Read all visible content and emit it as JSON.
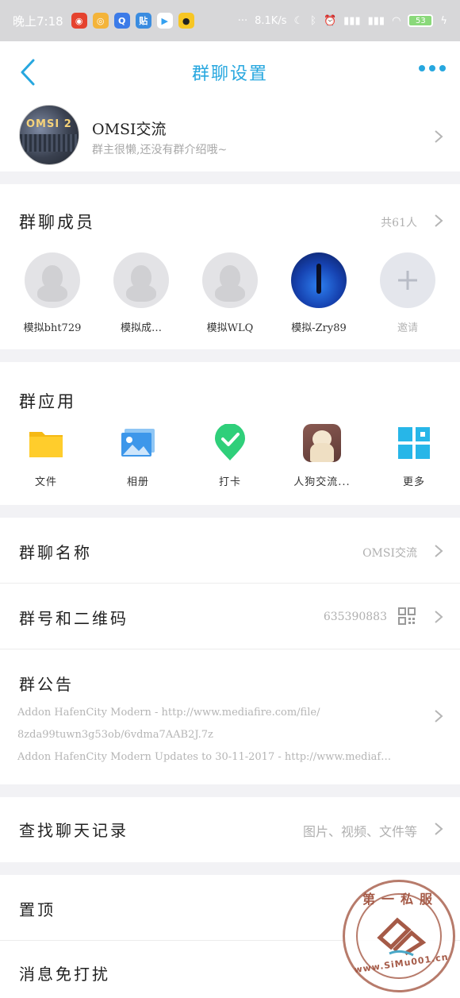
{
  "status_bar": {
    "time": "晚上7:18",
    "dots": "···",
    "speed": "8.1K/s",
    "battery": "53"
  },
  "nav": {
    "title": "群聊设置"
  },
  "group": {
    "name": "OMSI交流",
    "description": "群主很懒,还没有群介绍哦~",
    "avatar_text": "OMSI 2"
  },
  "members": {
    "title": "群聊成员",
    "count": "共61人",
    "items": [
      {
        "label": "模拟bht729"
      },
      {
        "label": "模拟成…"
      },
      {
        "label": "模拟WLQ"
      },
      {
        "label": "模拟-Zry89"
      },
      {
        "label": "邀请"
      }
    ]
  },
  "apps": {
    "title": "群应用",
    "items": [
      {
        "label": "文件",
        "icon": "folder-icon"
      },
      {
        "label": "相册",
        "icon": "photo-album-icon"
      },
      {
        "label": "打卡",
        "icon": "checkin-icon"
      },
      {
        "label": "人狗交流...",
        "icon": "dog-photo-icon"
      },
      {
        "label": "更多",
        "icon": "grid-more-icon"
      }
    ]
  },
  "settings": {
    "group_name_label": "群聊名称",
    "group_name_value": "OMSI交流",
    "group_id_label": "群号和二维码",
    "group_id_value": "635390883",
    "notice_label": "群公告",
    "notice_line1": "Addon HafenCity Modern - http://www.mediafire.com/file/",
    "notice_line2": "8zda99tuwn3g53ob/6vdma7AAB2J.7z",
    "notice_line3": "Addon HafenCity Modern Updates to 30-11-2017 - http://www.mediaf…",
    "search_label": "查找聊天记录",
    "search_value": "图片、视频、文件等",
    "pin_label": "置顶",
    "mute_label": "消息免打扰"
  },
  "watermark": {
    "top_text": "第一私服",
    "bottom_text": "www.SiMu001.cn"
  },
  "colors": {
    "accent": "#27a7df",
    "background": "#f2f2f5",
    "secondary_text": "#b0b0b0"
  }
}
